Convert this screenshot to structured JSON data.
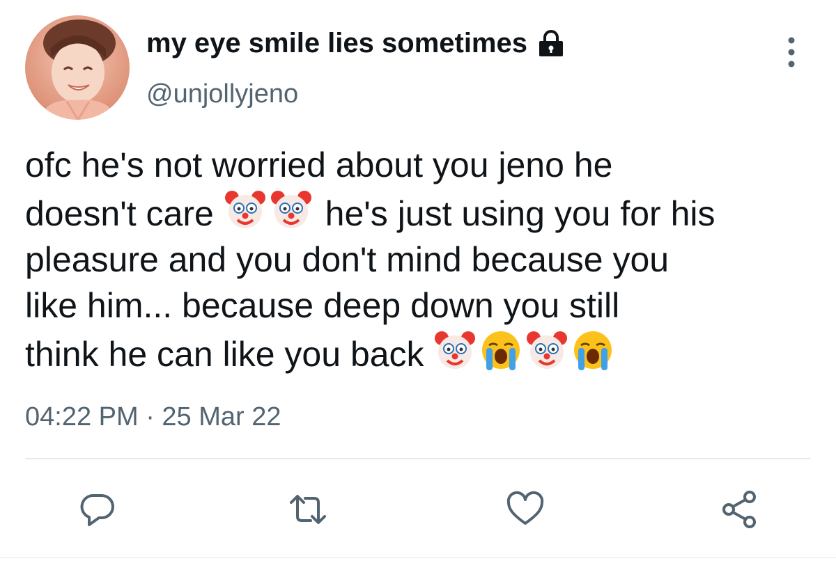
{
  "author": {
    "display_name": "my eye smile lies sometimes",
    "handle": "@unjollyjeno",
    "protected_icon": "lock-icon",
    "avatar_icon": "avatar"
  },
  "tweet": {
    "lines": [
      "ofc he's not worried about you jeno he",
      "doesn't care",
      "he's just using you for his",
      "pleasure and you don't mind because you",
      "like him... because deep down you still",
      "think he can like you back"
    ],
    "emojis": [
      "clown-face",
      "clown-face",
      "clown-face",
      "loudly-crying-face",
      "clown-face",
      "loudly-crying-face"
    ]
  },
  "timestamp": "04:22 PM · 25 Mar 22",
  "actions": [
    "reply-icon",
    "retweet-icon",
    "like-icon",
    "share-icon"
  ],
  "colors": {
    "text": "#0f1419",
    "secondary": "#536471",
    "divider": "#e6e9ec"
  }
}
